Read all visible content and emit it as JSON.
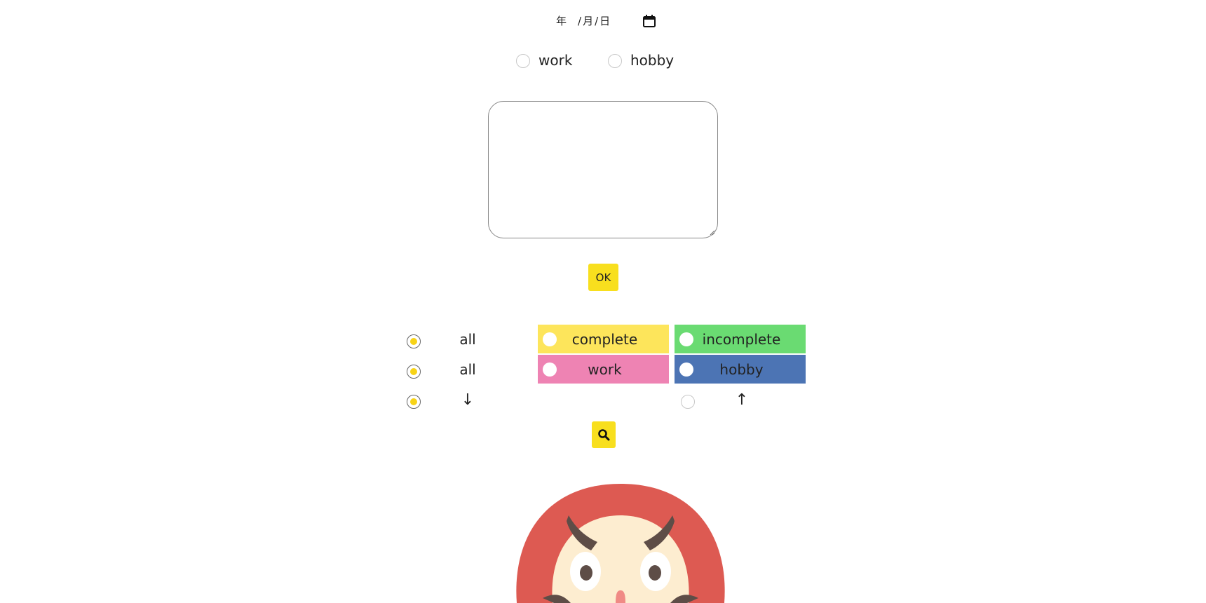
{
  "date_input": {
    "year_placeholder": "年",
    "month_placeholder": "月",
    "day_placeholder": "日",
    "separator": "/",
    "calendar_icon": "calendar-icon"
  },
  "category": {
    "options": [
      {
        "label": "work",
        "selected": false
      },
      {
        "label": "hobby",
        "selected": false
      }
    ]
  },
  "memo": {
    "value": "",
    "placeholder": ""
  },
  "ok_button": {
    "label": "OK",
    "color": "#f8df1e"
  },
  "filters": {
    "status": {
      "all_label": "all",
      "all_selected": true,
      "options": [
        {
          "label": "complete",
          "color": "#fde55b",
          "selected": false
        },
        {
          "label": "incomplete",
          "color": "#6adb72",
          "selected": false
        }
      ]
    },
    "category": {
      "all_label": "all",
      "all_selected": true,
      "options": [
        {
          "label": "work",
          "color": "#ee83b3",
          "selected": false
        },
        {
          "label": "hobby",
          "color": "#4c74b4",
          "selected": false
        }
      ]
    },
    "sort": {
      "desc_label": "↓",
      "desc_selected": true,
      "asc_label": "↑",
      "asc_selected": false
    }
  },
  "search_button": {
    "icon": "search-icon",
    "color": "#f8df1e"
  },
  "mascot": {
    "icon": "daruma-illustration"
  },
  "colors": {
    "accent": "#f8df1e",
    "radio_dot": "#f7d317"
  }
}
